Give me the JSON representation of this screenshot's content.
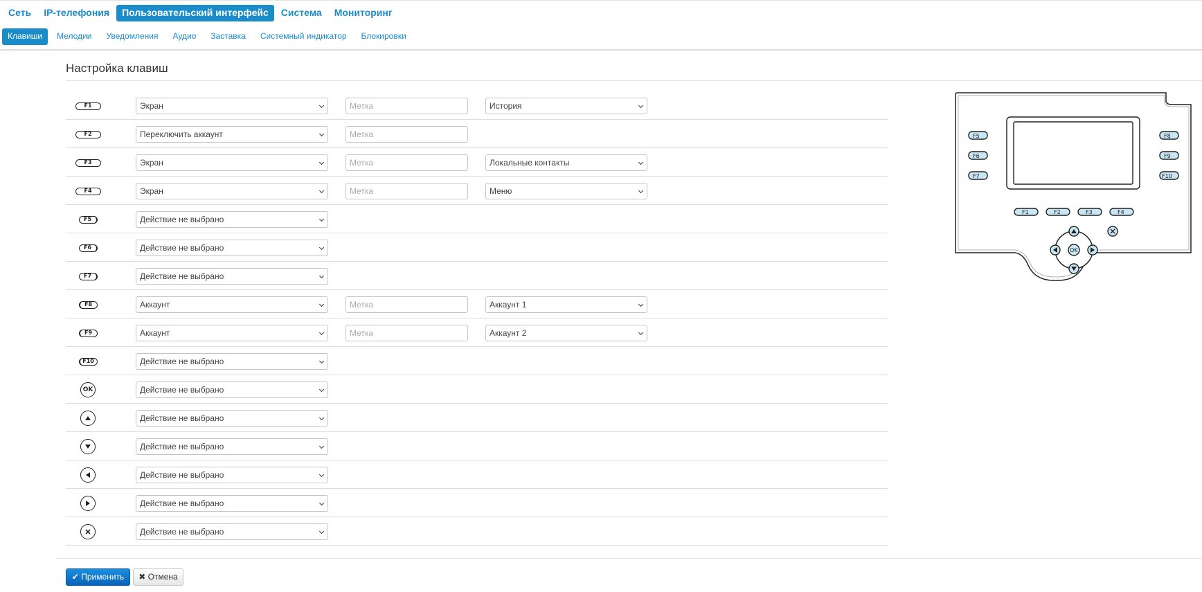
{
  "nav": {
    "main": [
      "Сеть",
      "IP-телефония",
      "Пользовательский интерфейс",
      "Система",
      "Мониторинг"
    ],
    "sub": [
      "Клавиши",
      "Мелодии",
      "Уведомления",
      "Аудио",
      "Заставка",
      "Системный индикатор",
      "Блокировки"
    ]
  },
  "page": {
    "title": "Настройка клавиш"
  },
  "placeholder_label": "Метка",
  "rows": [
    {
      "key": "F1",
      "action": "Экран",
      "label_placeholder": "Метка",
      "param": "История"
    },
    {
      "key": "F2",
      "action": "Переключить аккаунт",
      "label_placeholder": "Метка",
      "param": ""
    },
    {
      "key": "F3",
      "action": "Экран",
      "label_placeholder": "Метка",
      "param": "Локальные контакты"
    },
    {
      "key": "F4",
      "action": "Экран",
      "label_placeholder": "Метка",
      "param": "Меню"
    },
    {
      "key": "F5",
      "action": "Действие не выбрано"
    },
    {
      "key": "F6",
      "action": "Действие не выбрано"
    },
    {
      "key": "F7",
      "action": "Действие не выбрано"
    },
    {
      "key": "F8",
      "action": "Аккаунт",
      "label_placeholder": "Метка",
      "param": "Аккаунт 1"
    },
    {
      "key": "F9",
      "action": "Аккаунт",
      "label_placeholder": "Метка",
      "param": "Аккаунт 2"
    },
    {
      "key": "F10",
      "action": "Действие не выбрано"
    },
    {
      "key": "OK",
      "action": "Действие не выбрано"
    },
    {
      "key": "up",
      "action": "Действие не выбрано"
    },
    {
      "key": "down",
      "action": "Действие не выбрано"
    },
    {
      "key": "left",
      "action": "Действие не выбрано"
    },
    {
      "key": "right",
      "action": "Действие не выбрано"
    },
    {
      "key": "cancel",
      "action": "Действие не выбрано"
    }
  ],
  "buttons": {
    "apply": "Применить",
    "cancel": "Отмена"
  },
  "phone_keys": {
    "left": [
      "F5",
      "F6",
      "F7"
    ],
    "right": [
      "F8",
      "F9",
      "F10"
    ],
    "bottom": [
      "F1",
      "F2",
      "F3",
      "F4"
    ],
    "ok": "OK"
  },
  "colors": {
    "accent": "#1a8cc9",
    "apply_button": "#0b62b8",
    "key_fill": "#c9e6f4"
  }
}
